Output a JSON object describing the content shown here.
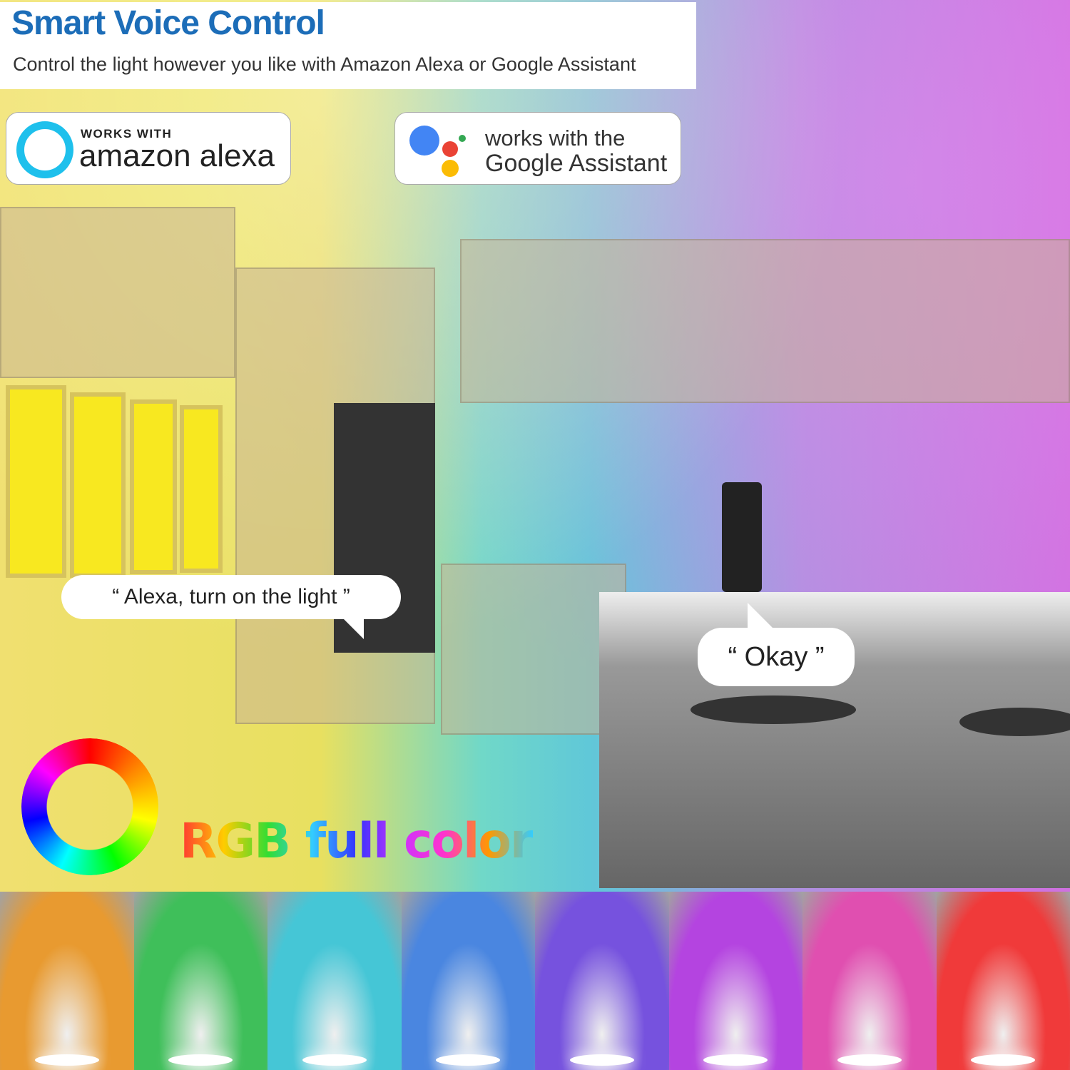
{
  "header": {
    "title": "Smart Voice Control",
    "subtitle": "Control the light however you like with Amazon Alexa or Google Assistant"
  },
  "badges": {
    "alexa": {
      "line1": "WORKS WITH",
      "line2": "amazon alexa",
      "color": "#1ec0ec"
    },
    "google": {
      "line1": "works with the",
      "line2": "Google Assistant",
      "dot_colors": [
        "#4285f4",
        "#ea4335",
        "#34a853",
        "#fbbc05"
      ]
    }
  },
  "speech": {
    "user": "“ Alexa, turn on the light ”",
    "reply": "“ Okay ”"
  },
  "feature": {
    "label": "RGB full color"
  },
  "swatches": [
    "#e89a30",
    "#3fbf5a",
    "#45c6d6",
    "#4a86e0",
    "#7652de",
    "#b444e0",
    "#e04fb0",
    "#f03a3a"
  ]
}
